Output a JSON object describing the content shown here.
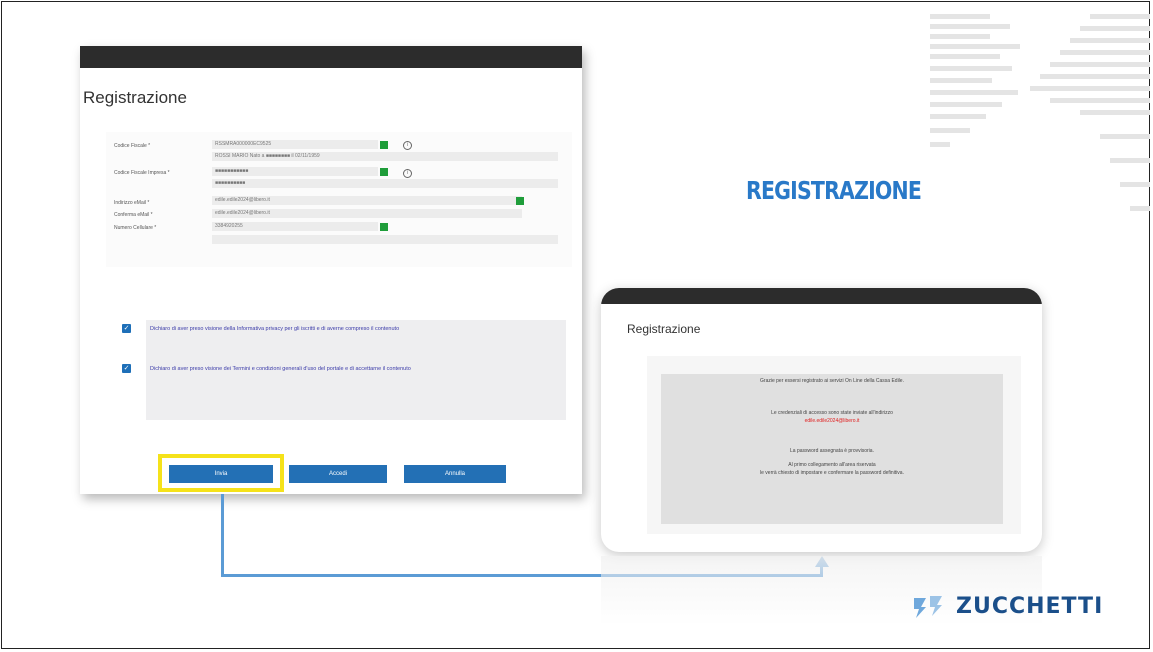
{
  "slide": {
    "title": "REGISTRAZIONE"
  },
  "registration_form": {
    "title": "Registrazione",
    "fields": [
      {
        "label": "Codice Fiscale *",
        "value": "RSSMRA000000EC9525",
        "subvalue": "ROSSI MARIO Nato a ■■■■■■■■ il 02/11/1959"
      },
      {
        "label": "Codice Fiscale Impresa *",
        "value": "■■■■■■■■■■■",
        "subvalue": "■■■■■■■■■■"
      },
      {
        "label": "Indirizzo eMail *",
        "value": "edile.edile2024@libero.it"
      },
      {
        "label": "Conferma eMail *",
        "value": "edile.edile2024@libero.it"
      },
      {
        "label": "Numero Cellulare *",
        "value": "3384920255"
      }
    ],
    "checkbox_privacy": "Dichiaro di aver preso visione della Informativa privacy per gli iscritti e di averne compreso il contenuto",
    "checkbox_terms": "Dichiaro di aver preso visione dei Termini e condizioni generali d'uso del portale e di accettarne il contenuto",
    "buttons": {
      "invia": "Invia",
      "accedi": "Accedi",
      "annulla": "Annulla"
    }
  },
  "confirmation": {
    "title": "Registrazione",
    "line1": "Grazie per essersi registrato ai servizi On Line della Cassa Edile.",
    "line2": "Le credenziali di accesso sono state inviate all'indirizzo",
    "email": "edile.edile2024@libero.it",
    "line3": "La password assegnata è provvisoria.",
    "line4": "Al primo collegamento all'area riservata",
    "line5": "le verrà chiesto di impostare e confermare la password definitiva."
  },
  "logo": {
    "text": "ZUCCHETTI"
  },
  "colors": {
    "accent_blue": "#2979c8",
    "button_blue": "#2370b5",
    "highlight_yellow": "#f5e21a",
    "brand_navy": "#1b4f8a",
    "arrow_blue": "#5b9bd5"
  }
}
